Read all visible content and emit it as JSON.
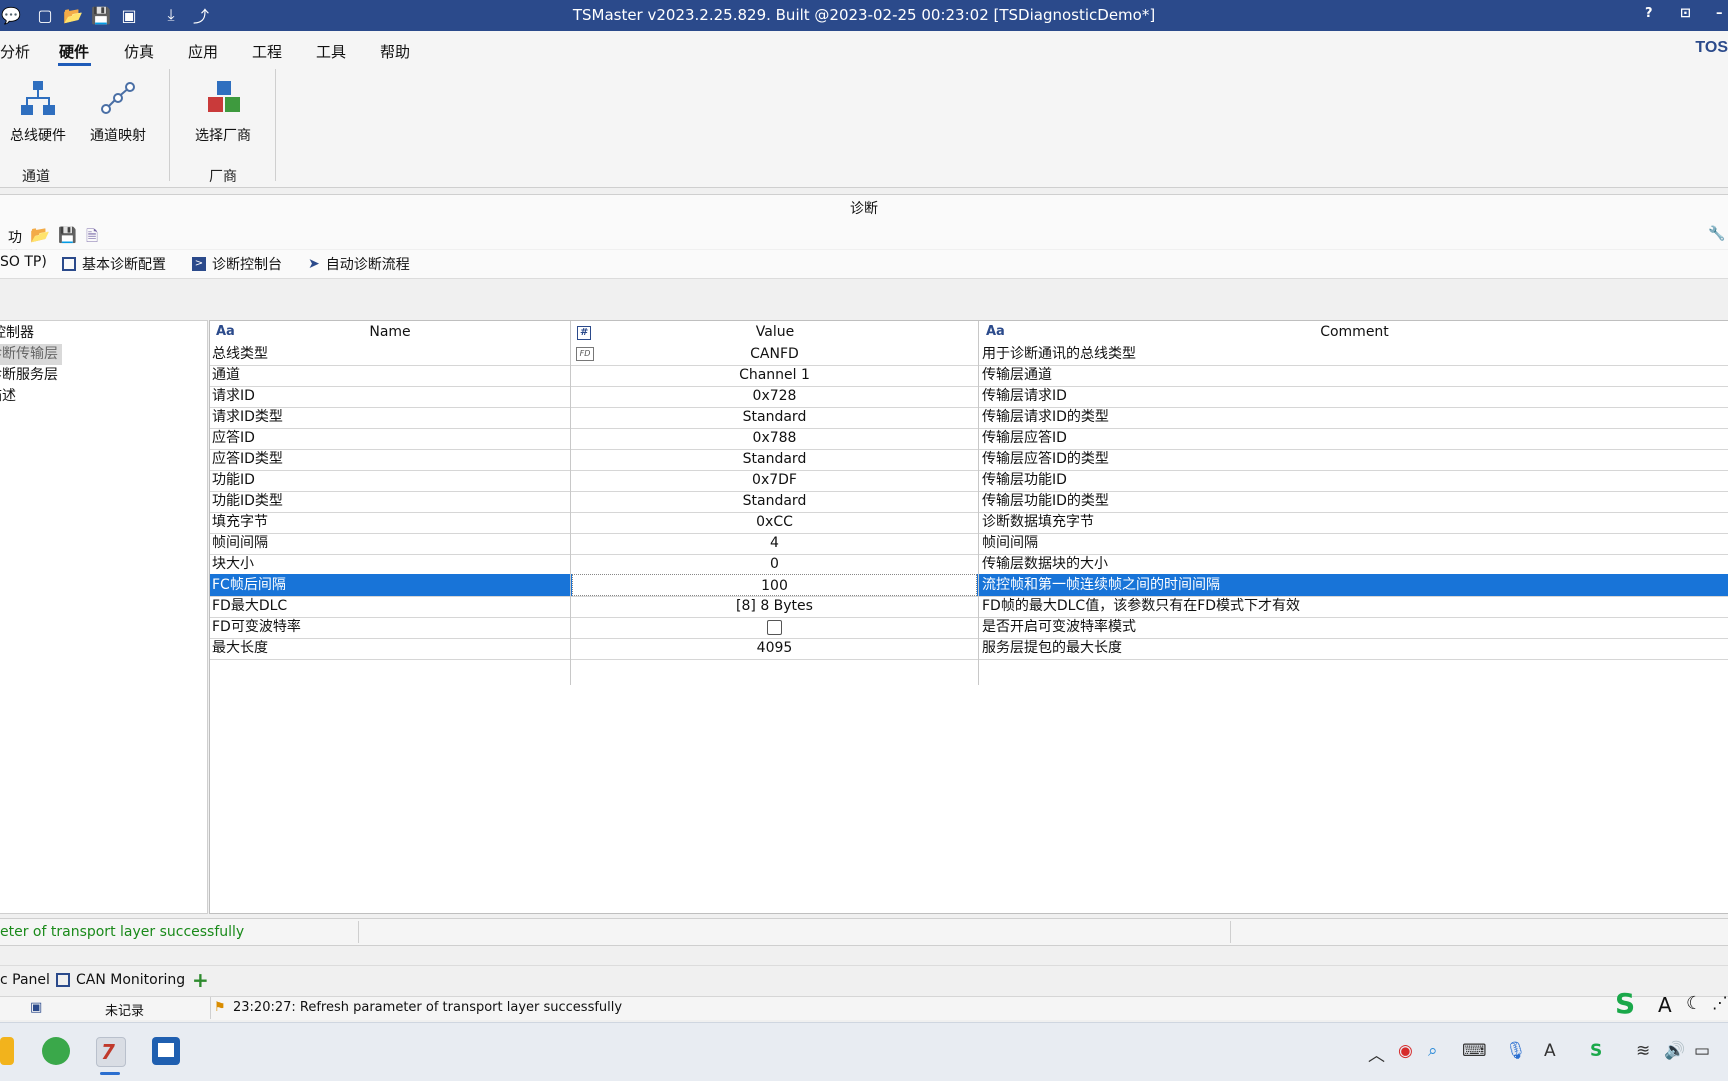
{
  "window": {
    "title": "TSMaster v2023.2.25.829. Built @2023-02-25 00:23:02 [TSDiagnosticDemo*]",
    "help_label": "?",
    "brand_text": "TOS"
  },
  "menu": {
    "items": [
      "分析",
      "硬件",
      "仿真",
      "应用",
      "工程",
      "工具",
      "帮助"
    ],
    "active": "硬件"
  },
  "ribbon": {
    "bus_hardware_label": "总线硬件",
    "channel_mapping_label": "通道映射",
    "channel_group_label": "通道",
    "select_vendor_label": "选择厂商",
    "vendor_group_label": "厂商"
  },
  "diagnostics": {
    "header_title": "诊断",
    "toolbar_label": "功能",
    "tabs": [
      "SO TP)",
      "基本诊断配置",
      "诊断控制台",
      "自动诊断流程"
    ],
    "tree": [
      "控制器",
      "诊断传输层",
      "诊断服务层",
      "描述"
    ],
    "tree_selected": "诊断传输层",
    "columns": {
      "name": "Name",
      "value": "Value",
      "comment": "Comment",
      "aa": "Aa",
      "hash": "#"
    },
    "rows": [
      {
        "name": "总线类型",
        "value": "CANFD",
        "comment": "用于诊断通讯的总线类型"
      },
      {
        "name": "通道",
        "value": "Channel 1",
        "comment": "传输层通道"
      },
      {
        "name": "请求ID",
        "value": "0x728",
        "comment": "传输层请求ID"
      },
      {
        "name": "请求ID类型",
        "value": "Standard",
        "comment": "传输层请求ID的类型"
      },
      {
        "name": "应答ID",
        "value": "0x788",
        "comment": "传输层应答ID"
      },
      {
        "name": "应答ID类型",
        "value": "Standard",
        "comment": "传输层应答ID的类型"
      },
      {
        "name": "功能ID",
        "value": "0x7DF",
        "comment": "传输层功能ID"
      },
      {
        "name": "功能ID类型",
        "value": "Standard",
        "comment": "传输层功能ID的类型"
      },
      {
        "name": "填充字节",
        "value": "0xCC",
        "comment": "诊断数据填充字节"
      },
      {
        "name": "帧间间隔",
        "value": "4",
        "comment": "帧间间隔"
      },
      {
        "name": "块大小",
        "value": "0",
        "comment": "传输层数据块的大小"
      },
      {
        "name": "FC帧后间隔",
        "value": "100",
        "comment": "流控帧和第一帧连续帧之间的时间间隔"
      },
      {
        "name": "FD最大DLC",
        "value": "[8]  8 Bytes",
        "comment": "FD帧的最大DLC值，该参数只有在FD模式下才有效"
      },
      {
        "name": "FD可变波特率",
        "value": "",
        "comment": "是否开启可变波特率模式"
      },
      {
        "name": "最大长度",
        "value": "4095",
        "comment": "服务层提包的最大长度"
      }
    ],
    "fd_badge": "FD",
    "selected_row": 11,
    "fd_variable_baud_checked": false
  },
  "status": {
    "panel_message": "eter of transport layer successfully",
    "bottom_tabs": [
      "c Panel",
      "CAN Monitoring"
    ],
    "add_tab_label": "+",
    "record_status": "未记录",
    "log_message": "23:20:27: Refresh parameter of transport layer successfully"
  }
}
